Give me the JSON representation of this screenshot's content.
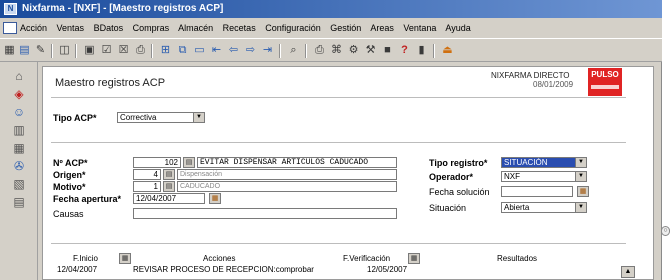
{
  "window": {
    "title": "Nixfarma - [NXF] - [Maestro registros ACP]",
    "app_icon": "app-icon"
  },
  "menu": [
    "Acción",
    "Ventas",
    "BDatos",
    "Compras",
    "Almacén",
    "Recetas",
    "Configuración",
    "Gestión",
    "Areas",
    "Ventana",
    "Ayuda"
  ],
  "form": {
    "title": "Maestro registros ACP",
    "company": "NIXFARMA DIRECTO",
    "date": "08/01/2009",
    "logo": "PULSO"
  },
  "tipo_acp": {
    "label": "Tipo ACP*",
    "value": "Correctiva"
  },
  "n_acp": {
    "label": "Nº ACP*",
    "value": "102",
    "title": "EVITAR DISPENSAR ARTICULOS CADUCADO"
  },
  "origen": {
    "label": "Origen*",
    "value": "4",
    "desc": "Dispensación"
  },
  "motivo": {
    "label": "Motivo*",
    "value": "1",
    "desc": "CADUCADO"
  },
  "fecha_apertura": {
    "label": "Fecha apertura*",
    "value": "12/04/2007"
  },
  "causas": {
    "label": "Causas",
    "value": ""
  },
  "tipo_registro": {
    "label": "Tipo registro*",
    "value": "SITUACIÓN"
  },
  "operador": {
    "label": "Operador*",
    "value": "NXF"
  },
  "fecha_solucion": {
    "label": "Fecha solución",
    "value": ""
  },
  "situacion": {
    "label": "Situación",
    "value": "Abierta"
  },
  "grid": {
    "headers": {
      "inicio": "F.Inicio",
      "acciones": "Acciones",
      "verificacion": "F.Verificación",
      "resultados": "Resultados"
    },
    "row": {
      "inicio": "12/04/2007",
      "acciones": "REVISAR PROCESO DE RECEPCION:comprobar",
      "verificacion": "12/05/2007",
      "resultados": ""
    }
  },
  "colors": {
    "titlebar": "#1a4b9c",
    "selection": "#2a4db0",
    "logo": "#e02424"
  }
}
